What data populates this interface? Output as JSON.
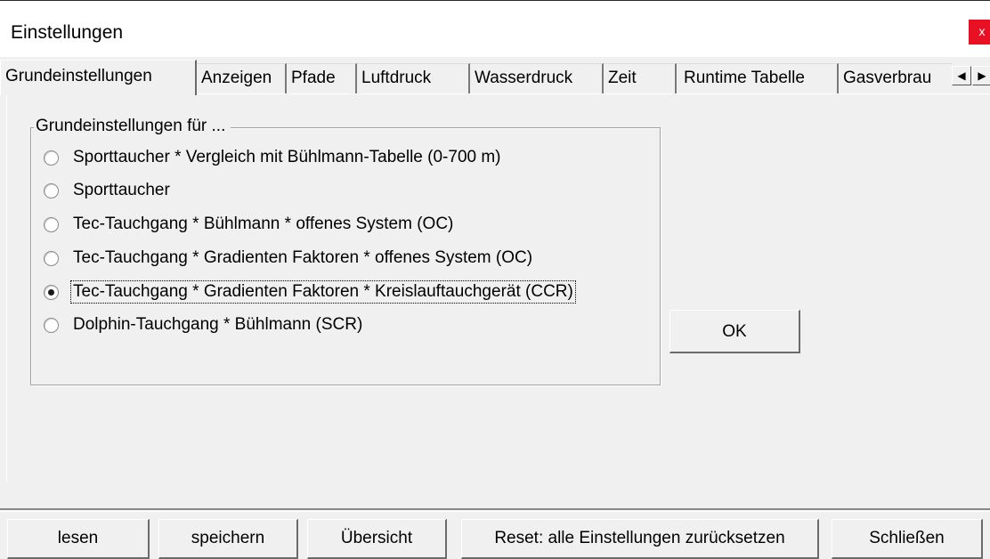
{
  "window": {
    "title": "Einstellungen",
    "close_label": "x"
  },
  "tabs": [
    {
      "label": "Grundeinstellungen",
      "active": true
    },
    {
      "label": "Anzeigen"
    },
    {
      "label": "Pfade"
    },
    {
      "label": "Luftdruck"
    },
    {
      "label": "Wasserdruck"
    },
    {
      "label": "Zeit"
    },
    {
      "label": "Runtime Tabelle"
    },
    {
      "label": "Gasverbrau"
    }
  ],
  "tab_scroll": {
    "left_icon": "◀",
    "right_icon": "▶"
  },
  "group": {
    "legend": "Grundeinstellungen für ...",
    "options": [
      {
        "label": "Sporttaucher * Vergleich mit Bühlmann-Tabelle (0-700 m)",
        "checked": false
      },
      {
        "label": "Sporttaucher",
        "checked": false
      },
      {
        "label": "Tec-Tauchgang * Bühlmann * offenes System (OC)",
        "checked": false
      },
      {
        "label": "Tec-Tauchgang * Gradienten Faktoren * offenes System (OC)",
        "checked": false
      },
      {
        "label": "Tec-Tauchgang * Gradienten Faktoren * Kreislauftauchgerät (CCR)",
        "checked": true
      },
      {
        "label": "Dolphin-Tauchgang * Bühlmann (SCR)",
        "checked": false
      }
    ]
  },
  "ok_label": "OK",
  "bottom_buttons": {
    "read": "lesen",
    "save": "speichern",
    "overview": "Übersicht",
    "reset": "Reset: alle Einstellungen zurücksetzen",
    "close": "Schließen"
  },
  "colors": {
    "close_button": "#e81123",
    "background": "#f0f0f0",
    "titlebar": "#ffffff"
  }
}
